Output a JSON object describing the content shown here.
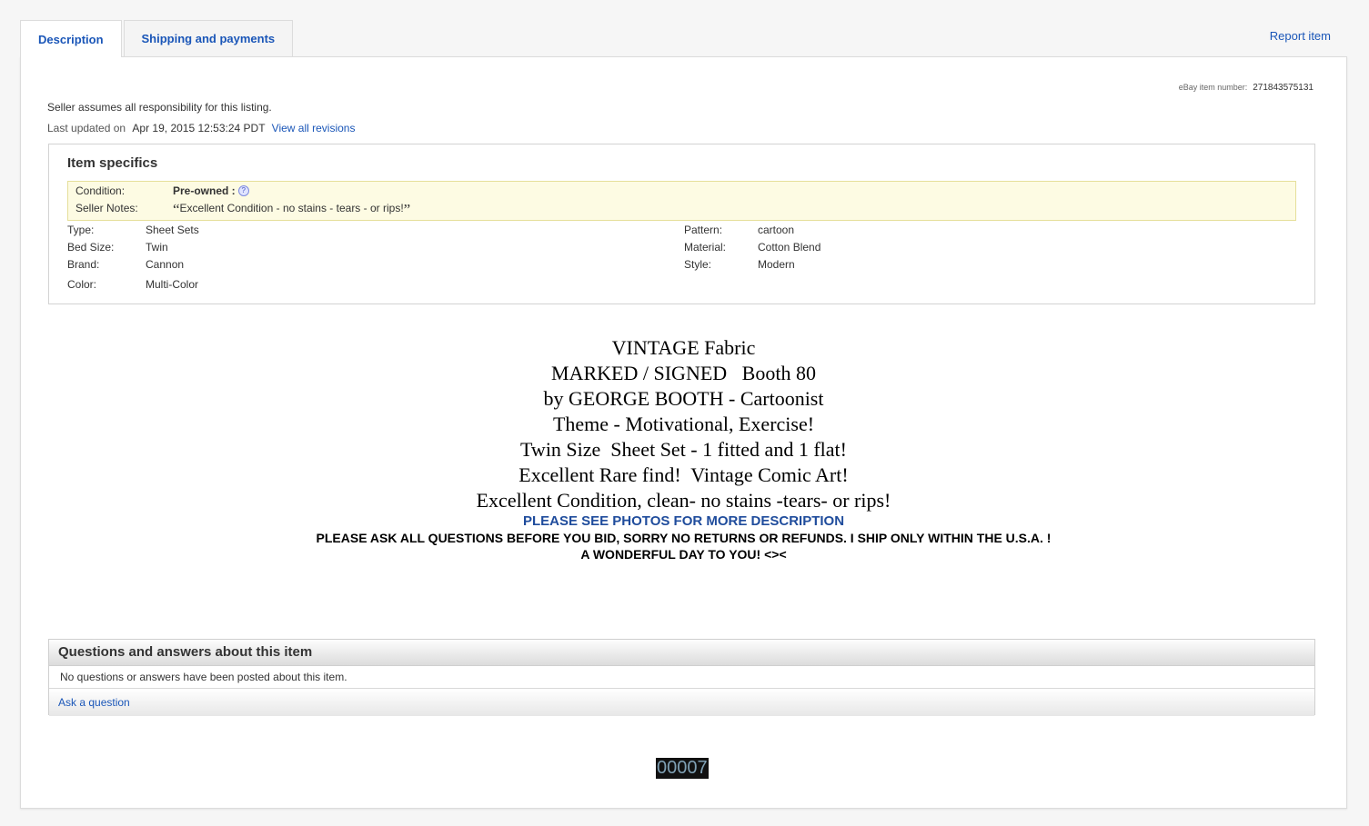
{
  "tabs": [
    {
      "label": "Description"
    },
    {
      "label": "Shipping and payments"
    }
  ],
  "report_item": "Report item",
  "item_number": {
    "label": "eBay item number:",
    "value": "271843575131"
  },
  "seller_responsibility": "Seller assumes all responsibility for this listing.",
  "last_updated": {
    "label": "Last updated on",
    "date": "Apr 19, 2015 12:53:24 PDT",
    "revisions_link": "View all revisions"
  },
  "specifics": {
    "title": "Item specifics",
    "condition_label": "Condition:",
    "condition_value": "Pre-owned :",
    "seller_notes_label": "Seller Notes:",
    "seller_notes_open": "“",
    "seller_notes_value": "Excellent Condition - no stains - tears - or rips!",
    "seller_notes_close": "”",
    "left": [
      {
        "k": "Type:",
        "v": "Sheet Sets"
      },
      {
        "k": "Bed Size:",
        "v": "Twin"
      },
      {
        "k": "Brand:",
        "v": "Cannon"
      },
      {
        "k": "Color:",
        "v": "Multi-Color"
      }
    ],
    "right": [
      {
        "k": "Pattern:",
        "v": "cartoon"
      },
      {
        "k": "Material:",
        "v": "Cotton Blend"
      },
      {
        "k": "Style:",
        "v": "Modern"
      }
    ]
  },
  "description": {
    "serif_lines": [
      "VINTAGE Fabric",
      "MARKED / SIGNED   Booth 80",
      "by GEORGE BOOTH - Cartoonist",
      "Theme - Motivational, Exercise!",
      "Twin Size  Sheet Set - 1 fitted and 1 flat!",
      "Excellent Rare find!  Vintage Comic Art!",
      "Excellent Condition, clean- no stains -tears- or rips!"
    ],
    "photos_line": "PLEASE SEE PHOTOS FOR MORE DESCRIPTION",
    "questions_line": "PLEASE ASK ALL QUESTIONS BEFORE YOU BID, SORRY NO RETURNS OR REFUNDS. I SHIP ONLY WITHIN THE U.S.A. !",
    "closing_line": "A WONDERFUL DAY TO YOU! <><"
  },
  "qa": {
    "title": "Questions and answers about this item",
    "empty": "No questions or answers have been posted about this item.",
    "ask": "Ask a question"
  },
  "counter": "00007",
  "colors": {
    "link": "#1a56b8",
    "note_bg": "#fdfbe3",
    "blue_line": "#1f4c9c"
  }
}
